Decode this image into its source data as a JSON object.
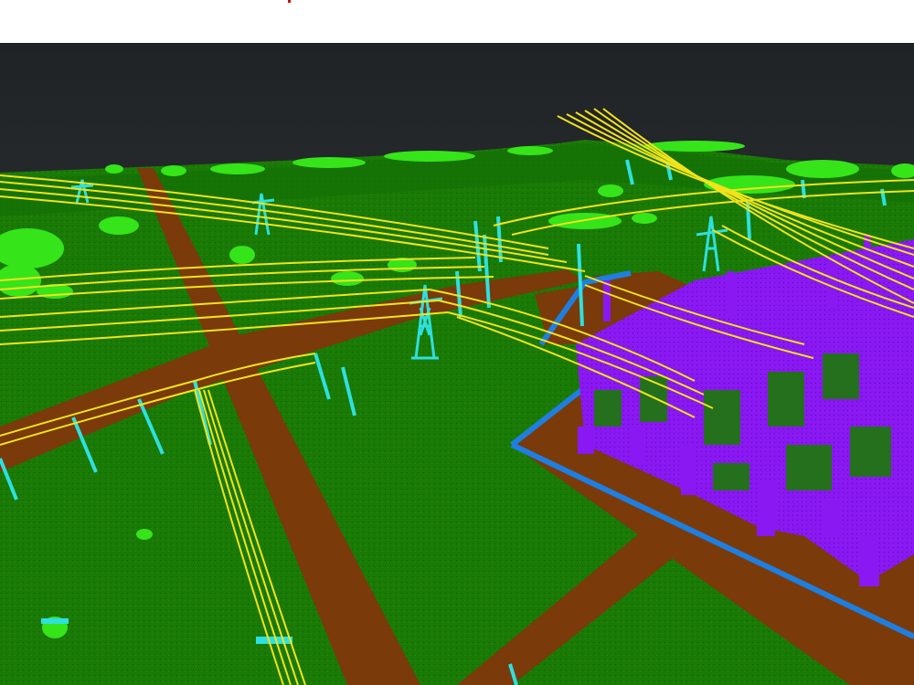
{
  "viewport": {
    "description_free": true
  },
  "colors": {
    "background_top": "#1f2326",
    "background_bottom": "#3b3f3e",
    "ground": "#1a7a06",
    "ground_dark": "#136603",
    "road": "#7a3a0a",
    "vegetation": "#36e41a",
    "power_line": "#f2e31c",
    "tower": "#2ee0e0",
    "substation": "#8a18f2",
    "fence": "#1e7fe0",
    "marker": "#d40000"
  },
  "legend_classes": [
    {
      "id": "ground",
      "icon": "ground-swatch"
    },
    {
      "id": "road",
      "icon": "road-swatch"
    },
    {
      "id": "vegetation",
      "icon": "vegetation-swatch"
    },
    {
      "id": "power_line",
      "icon": "power-line-swatch"
    },
    {
      "id": "tower",
      "icon": "tower-swatch"
    },
    {
      "id": "substation",
      "icon": "substation-swatch"
    },
    {
      "id": "fence",
      "icon": "fence-swatch"
    }
  ]
}
